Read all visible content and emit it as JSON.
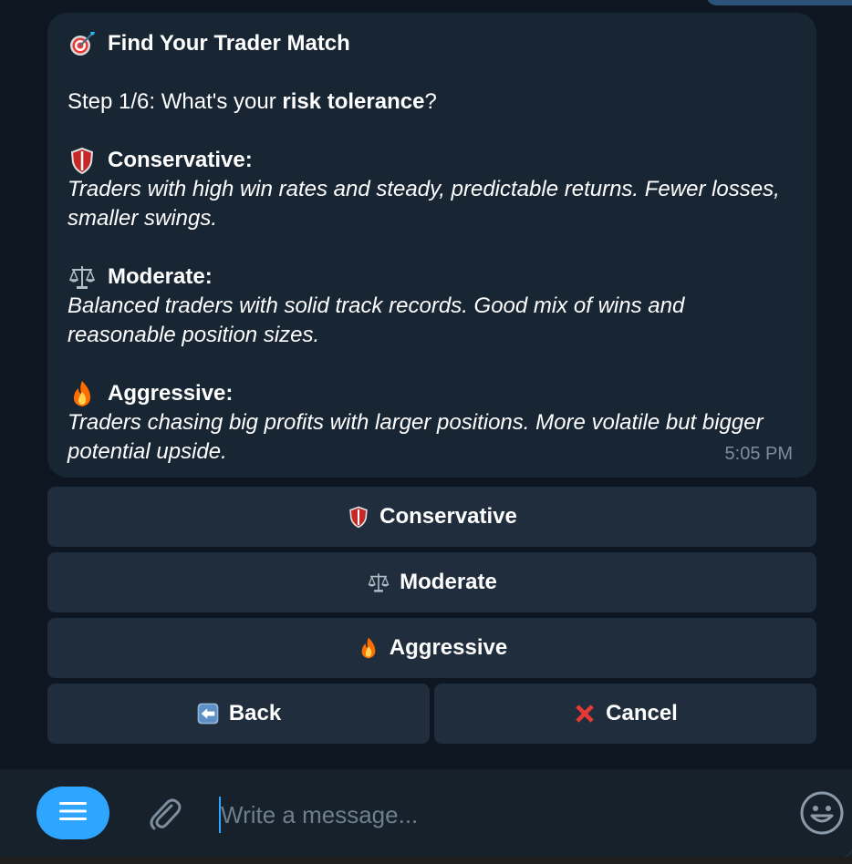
{
  "message": {
    "title": "Find Your Trader Match",
    "title_icon": "target-icon",
    "step_prefix": "Step 1/6: What's your ",
    "step_bold": "risk tolerance",
    "step_suffix": "?",
    "options": [
      {
        "icon": "shield-icon",
        "heading": "Conservative:",
        "description": "Traders with high win rates and steady, predictable returns. Fewer losses, smaller swings."
      },
      {
        "icon": "scales-icon",
        "heading": "Moderate:",
        "description": "Balanced traders with solid track records. Good mix of wins and reasonable position sizes."
      },
      {
        "icon": "fire-icon",
        "heading": "Aggressive:",
        "description": "Traders chasing big profits with larger positions. More volatile but bigger potential upside."
      }
    ],
    "time": "5:05 PM"
  },
  "keyboard": {
    "conservative": "Conservative",
    "moderate": "Moderate",
    "aggressive": "Aggressive",
    "back": "Back",
    "cancel": "Cancel"
  },
  "composer": {
    "placeholder": "Write a message..."
  },
  "colors": {
    "bubble": "#182533",
    "button": "#1f2d3c",
    "accent": "#2ea6ff",
    "background": "#0e1621"
  }
}
